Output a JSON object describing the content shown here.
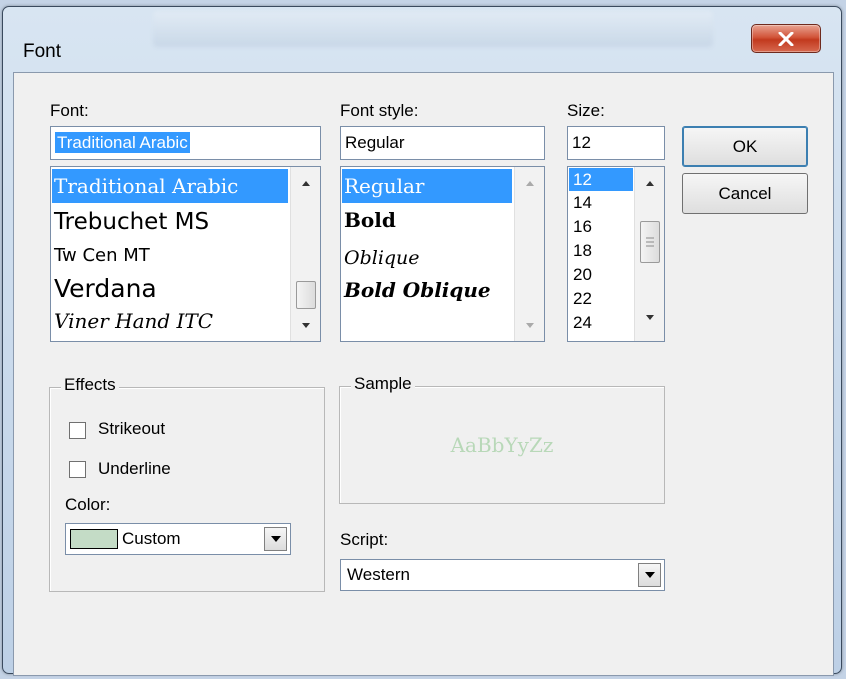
{
  "dialog": {
    "title": "Font",
    "close_glyph": "X"
  },
  "font": {
    "label": "Font:",
    "value": "Traditional Arabic",
    "items": [
      "Traditional Arabic",
      "Trebuchet MS",
      "Tw Cen MT",
      "Verdana",
      "Viner Hand ITC"
    ],
    "selected_index": 0
  },
  "font_style": {
    "label": "Font style:",
    "value": "Regular",
    "items": [
      "Regular",
      "Bold",
      "Oblique",
      "Bold Oblique"
    ],
    "selected_index": 0
  },
  "size": {
    "label": "Size:",
    "value": "12",
    "items": [
      "12",
      "14",
      "16",
      "18",
      "20",
      "22",
      "24"
    ],
    "selected_index": 0
  },
  "buttons": {
    "ok": "OK",
    "cancel": "Cancel"
  },
  "effects": {
    "legend": "Effects",
    "strikeout_label": "Strikeout",
    "strikeout_checked": false,
    "underline_label": "Underline",
    "underline_checked": false,
    "color_label": "Color:",
    "color_value": "Custom",
    "color_swatch": "#c4dcc6"
  },
  "sample": {
    "legend": "Sample",
    "text": "AaBbYyZz",
    "color": "#b8d8b8"
  },
  "script": {
    "label": "Script:",
    "value": "Western"
  },
  "colors": {
    "selection": "#3399ff",
    "dialog_bg": "#f0f0f0",
    "close_red": "#c2391e"
  }
}
